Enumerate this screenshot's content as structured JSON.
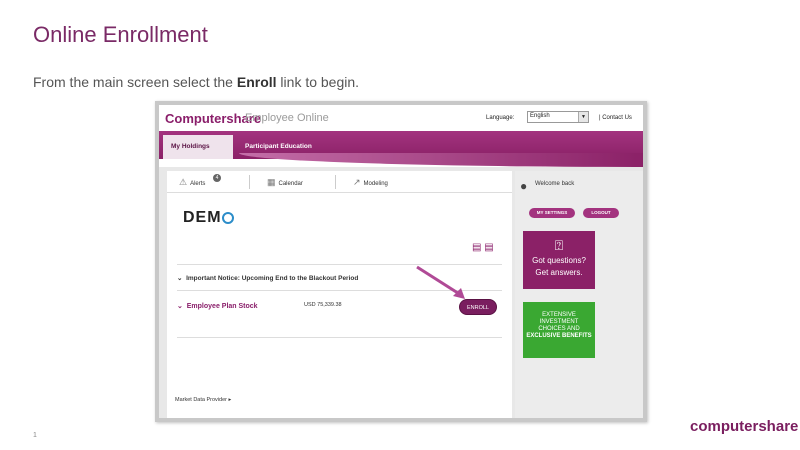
{
  "slide": {
    "title": "Online Enrollment",
    "subtitle_prefix": "From the main screen select the ",
    "subtitle_bold": "Enroll",
    "subtitle_suffix": " link to begin.",
    "page_number": "1",
    "brand": "computershare"
  },
  "app": {
    "logo": "Computershare",
    "product": "Employee Online",
    "language_label": "Language:",
    "language_value": "English",
    "contact": "| Contact Us",
    "tabs": [
      "My Holdings",
      "Participant Education"
    ],
    "toolbar": [
      {
        "icon": "warning-icon",
        "label": "Alerts",
        "badge": "4"
      },
      {
        "icon": "calendar-icon",
        "label": "Calendar"
      },
      {
        "icon": "chart-icon",
        "label": "Modeling"
      }
    ],
    "company": "DEM",
    "notice": "Important Notice: Upcoming End to the Blackout Period",
    "plan_name": "Employee Plan Stock",
    "plan_amount": "USD 75,339.38",
    "enroll": "ENROLL",
    "market_data": "Market Data Provider",
    "welcome": "Welcome back",
    "settings": "MY SETTINGS",
    "logout": "LOGOUT",
    "promo_line1": "Got questions?",
    "promo_line2": "Get answers.",
    "ad_line1": "EXTENSIVE",
    "ad_line2": "INVESTMENT",
    "ad_line3": "CHOICES AND",
    "ad_line4": "EXCLUSIVE BENEFITS"
  },
  "colors": {
    "accent": "#8a1e6a",
    "title": "#7a2a66",
    "ad_green": "#3aa832",
    "logo_blue": "#2c8dc9"
  }
}
